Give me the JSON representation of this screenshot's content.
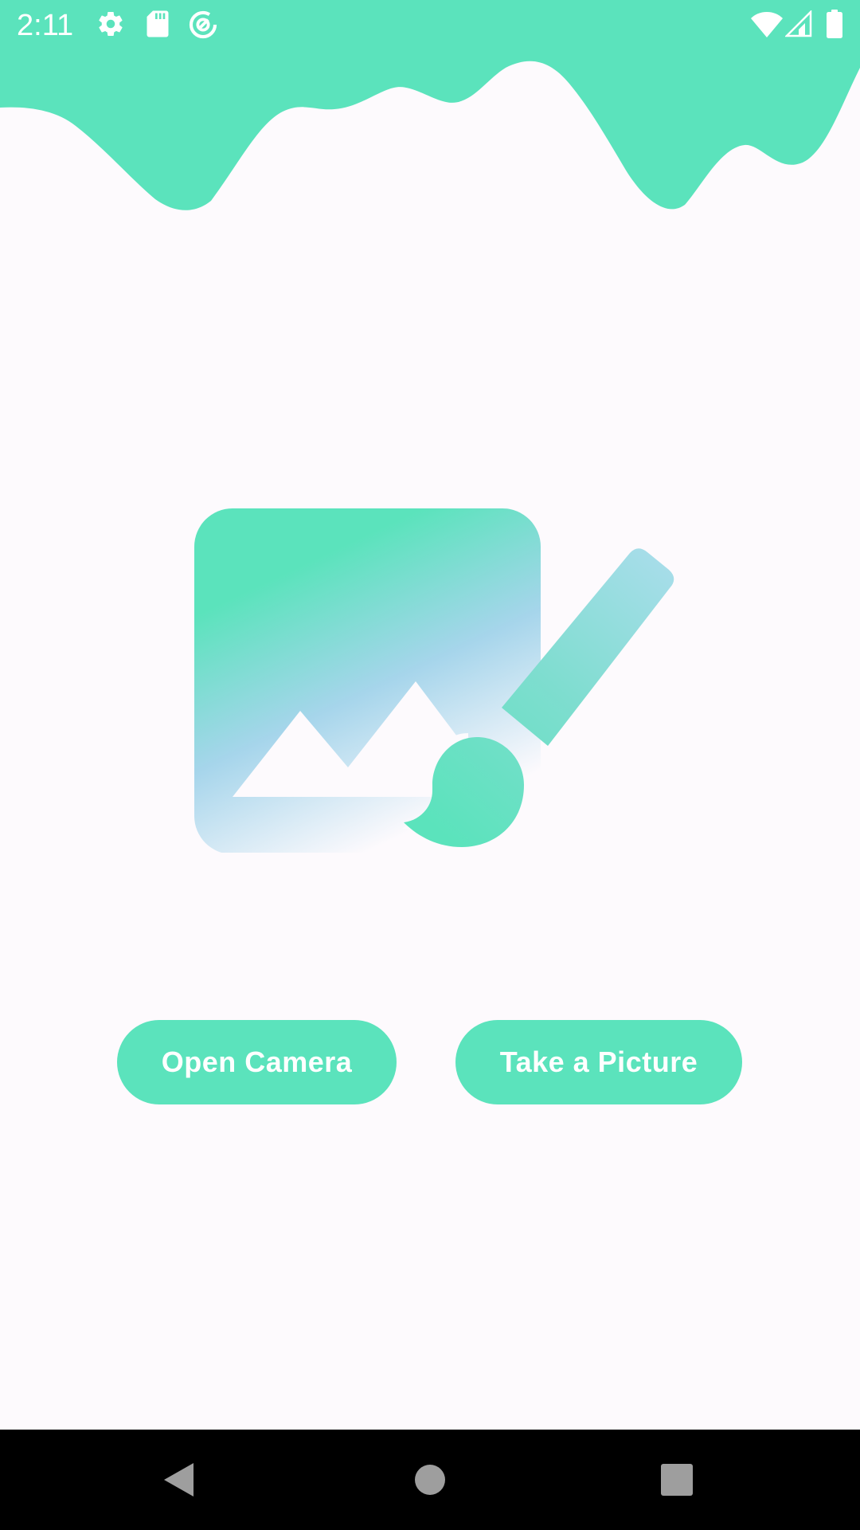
{
  "status_bar": {
    "time": "2:11",
    "icons": [
      "settings-gear-icon",
      "sd-card-icon",
      "data-saver-icon",
      "wifi-icon",
      "cell-signal-icon",
      "battery-icon"
    ]
  },
  "theme": {
    "accent": "#5BE3BC",
    "secondary": "#A3D6EA",
    "background": "#FDFAFD"
  },
  "hero": {
    "icon": "image-edit-icon"
  },
  "actions": {
    "open_camera_label": "Open Camera",
    "take_picture_label": "Take a Picture"
  },
  "nav_bar": {
    "icons": [
      "back-icon",
      "home-icon",
      "recents-icon"
    ]
  }
}
